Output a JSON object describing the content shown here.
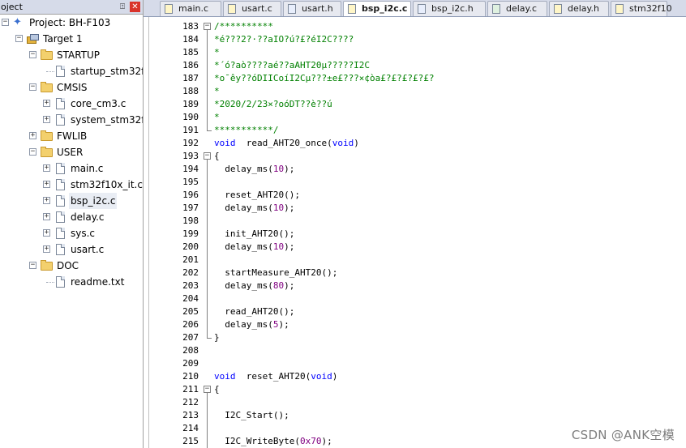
{
  "project_panel": {
    "title": "oject",
    "pin_glyph": "⍐",
    "close_glyph": "✕",
    "tree": [
      {
        "label": "Project: BH-F103",
        "type": "project",
        "level": 0,
        "expander": "-"
      },
      {
        "label": "Target 1",
        "type": "target",
        "level": 1,
        "expander": "-"
      },
      {
        "label": "STARTUP",
        "type": "folder",
        "level": 2,
        "expander": "-"
      },
      {
        "label": "startup_stm32f1",
        "type": "file",
        "level": 3,
        "expander": ""
      },
      {
        "label": "CMSIS",
        "type": "folder",
        "level": 2,
        "expander": "-"
      },
      {
        "label": "core_cm3.c",
        "type": "file",
        "level": 3,
        "expander": "+"
      },
      {
        "label": "system_stm32f1",
        "type": "file",
        "level": 3,
        "expander": "+"
      },
      {
        "label": "FWLIB",
        "type": "folder",
        "level": 2,
        "expander": "+"
      },
      {
        "label": "USER",
        "type": "folder",
        "level": 2,
        "expander": "-"
      },
      {
        "label": "main.c",
        "type": "file",
        "level": 3,
        "expander": "+"
      },
      {
        "label": "stm32f10x_it.c",
        "type": "file",
        "level": 3,
        "expander": "+"
      },
      {
        "label": "bsp_i2c.c",
        "type": "file",
        "level": 3,
        "expander": "+",
        "selected": true
      },
      {
        "label": "delay.c",
        "type": "file",
        "level": 3,
        "expander": "+"
      },
      {
        "label": "sys.c",
        "type": "file",
        "level": 3,
        "expander": "+"
      },
      {
        "label": "usart.c",
        "type": "file",
        "level": 3,
        "expander": "+"
      },
      {
        "label": "DOC",
        "type": "folder",
        "level": 2,
        "expander": "-"
      },
      {
        "label": "readme.txt",
        "type": "file",
        "level": 3,
        "expander": ""
      }
    ]
  },
  "tabs": [
    {
      "label": "main.c",
      "kind": "c",
      "active": false
    },
    {
      "label": "usart.c",
      "kind": "c",
      "active": false
    },
    {
      "label": "usart.h",
      "kind": "h",
      "active": false
    },
    {
      "label": "bsp_i2c.c",
      "kind": "c",
      "active": true
    },
    {
      "label": "bsp_i2c.h",
      "kind": "h",
      "active": false
    },
    {
      "label": "delay.c",
      "kind": "cpp",
      "active": false
    },
    {
      "label": "delay.h",
      "kind": "c",
      "active": false
    },
    {
      "label": "stm32f10",
      "kind": "c",
      "active": false
    }
  ],
  "editor": {
    "lines": [
      {
        "n": "183",
        "fold": "-",
        "indent": 0,
        "tokens": [
          [
            "cm",
            "/**********"
          ]
        ]
      },
      {
        "n": "184",
        "fold": "|",
        "indent": 0,
        "tokens": [
          [
            "cm",
            "*é???2?·??aIO?ú?£?éI2C????"
          ]
        ]
      },
      {
        "n": "185",
        "fold": "|",
        "indent": 0,
        "tokens": [
          [
            "cm",
            "*"
          ]
        ]
      },
      {
        "n": "186",
        "fold": "|",
        "indent": 0,
        "tokens": [
          [
            "cm",
            "*´ó?aò????aé??aAHT20µ?????I2C"
          ]
        ]
      },
      {
        "n": "187",
        "fold": "|",
        "indent": 0,
        "tokens": [
          [
            "cm",
            "*o¯êy??óDIICoíI2Cµ???±e£???×¢òa£?£?£?£?£?"
          ]
        ]
      },
      {
        "n": "188",
        "fold": "|",
        "indent": 0,
        "tokens": [
          [
            "cm",
            "*"
          ]
        ]
      },
      {
        "n": "189",
        "fold": "|",
        "indent": 0,
        "tokens": [
          [
            "cm",
            "*2020/2/23×?oóDT??è??ú"
          ]
        ]
      },
      {
        "n": "190",
        "fold": "|",
        "indent": 0,
        "tokens": [
          [
            "cm",
            "*"
          ]
        ]
      },
      {
        "n": "191",
        "fold": "end",
        "indent": 0,
        "tokens": [
          [
            "cm",
            "***********/"
          ]
        ]
      },
      {
        "n": "192",
        "fold": "",
        "indent": 0,
        "tokens": [
          [
            "kw",
            "void"
          ],
          [
            "",
            "  read_AHT20_once("
          ],
          [
            "kw",
            "void"
          ],
          [
            "",
            ")"
          ]
        ]
      },
      {
        "n": "193",
        "fold": "-",
        "indent": 0,
        "tokens": [
          [
            "",
            "{"
          ]
        ]
      },
      {
        "n": "194",
        "fold": "|",
        "indent": 2,
        "tokens": [
          [
            "",
            "delay_ms("
          ],
          [
            "num",
            "10"
          ],
          [
            "",
            ");"
          ]
        ]
      },
      {
        "n": "195",
        "fold": "|",
        "indent": 0,
        "tokens": []
      },
      {
        "n": "196",
        "fold": "|",
        "indent": 2,
        "tokens": [
          [
            "",
            "reset_AHT20();"
          ]
        ]
      },
      {
        "n": "197",
        "fold": "|",
        "indent": 2,
        "tokens": [
          [
            "",
            "delay_ms("
          ],
          [
            "num",
            "10"
          ],
          [
            "",
            ");"
          ]
        ]
      },
      {
        "n": "198",
        "fold": "|",
        "indent": 0,
        "tokens": []
      },
      {
        "n": "199",
        "fold": "|",
        "indent": 2,
        "tokens": [
          [
            "",
            "init_AHT20();"
          ]
        ]
      },
      {
        "n": "200",
        "fold": "|",
        "indent": 2,
        "tokens": [
          [
            "",
            "delay_ms("
          ],
          [
            "num",
            "10"
          ],
          [
            "",
            ");"
          ]
        ]
      },
      {
        "n": "201",
        "fold": "|",
        "indent": 0,
        "tokens": []
      },
      {
        "n": "202",
        "fold": "|",
        "indent": 2,
        "tokens": [
          [
            "",
            "startMeasure_AHT20();"
          ]
        ]
      },
      {
        "n": "203",
        "fold": "|",
        "indent": 2,
        "tokens": [
          [
            "",
            "delay_ms("
          ],
          [
            "num",
            "80"
          ],
          [
            "",
            ");"
          ]
        ]
      },
      {
        "n": "204",
        "fold": "|",
        "indent": 0,
        "tokens": []
      },
      {
        "n": "205",
        "fold": "|",
        "indent": 2,
        "tokens": [
          [
            "",
            "read_AHT20();"
          ]
        ]
      },
      {
        "n": "206",
        "fold": "|",
        "indent": 2,
        "tokens": [
          [
            "",
            "delay_ms("
          ],
          [
            "num",
            "5"
          ],
          [
            "",
            ");"
          ]
        ]
      },
      {
        "n": "207",
        "fold": "end",
        "indent": 0,
        "tokens": [
          [
            "",
            "}"
          ]
        ]
      },
      {
        "n": "208",
        "fold": "",
        "indent": 0,
        "tokens": []
      },
      {
        "n": "209",
        "fold": "",
        "indent": 0,
        "tokens": []
      },
      {
        "n": "210",
        "fold": "",
        "indent": 0,
        "tokens": [
          [
            "kw",
            "void"
          ],
          [
            "",
            "  reset_AHT20("
          ],
          [
            "kw",
            "void"
          ],
          [
            "",
            ")"
          ]
        ]
      },
      {
        "n": "211",
        "fold": "-",
        "indent": 0,
        "tokens": [
          [
            "",
            "{"
          ]
        ]
      },
      {
        "n": "212",
        "fold": "|",
        "indent": 0,
        "tokens": []
      },
      {
        "n": "213",
        "fold": "|",
        "indent": 2,
        "tokens": [
          [
            "",
            "I2C_Start();"
          ]
        ]
      },
      {
        "n": "214",
        "fold": "|",
        "indent": 0,
        "tokens": []
      },
      {
        "n": "215",
        "fold": "|",
        "indent": 2,
        "tokens": [
          [
            "",
            "I2C_WriteByte("
          ],
          [
            "num",
            "0x70"
          ],
          [
            "",
            ");"
          ]
        ]
      }
    ]
  },
  "watermark": "CSDN @ANK空模",
  "colors": {
    "comment": "#008000",
    "keyword": "#0000ff",
    "number": "#800080",
    "panel_header": "#d6dbe9",
    "folder": "#f3d06d"
  }
}
